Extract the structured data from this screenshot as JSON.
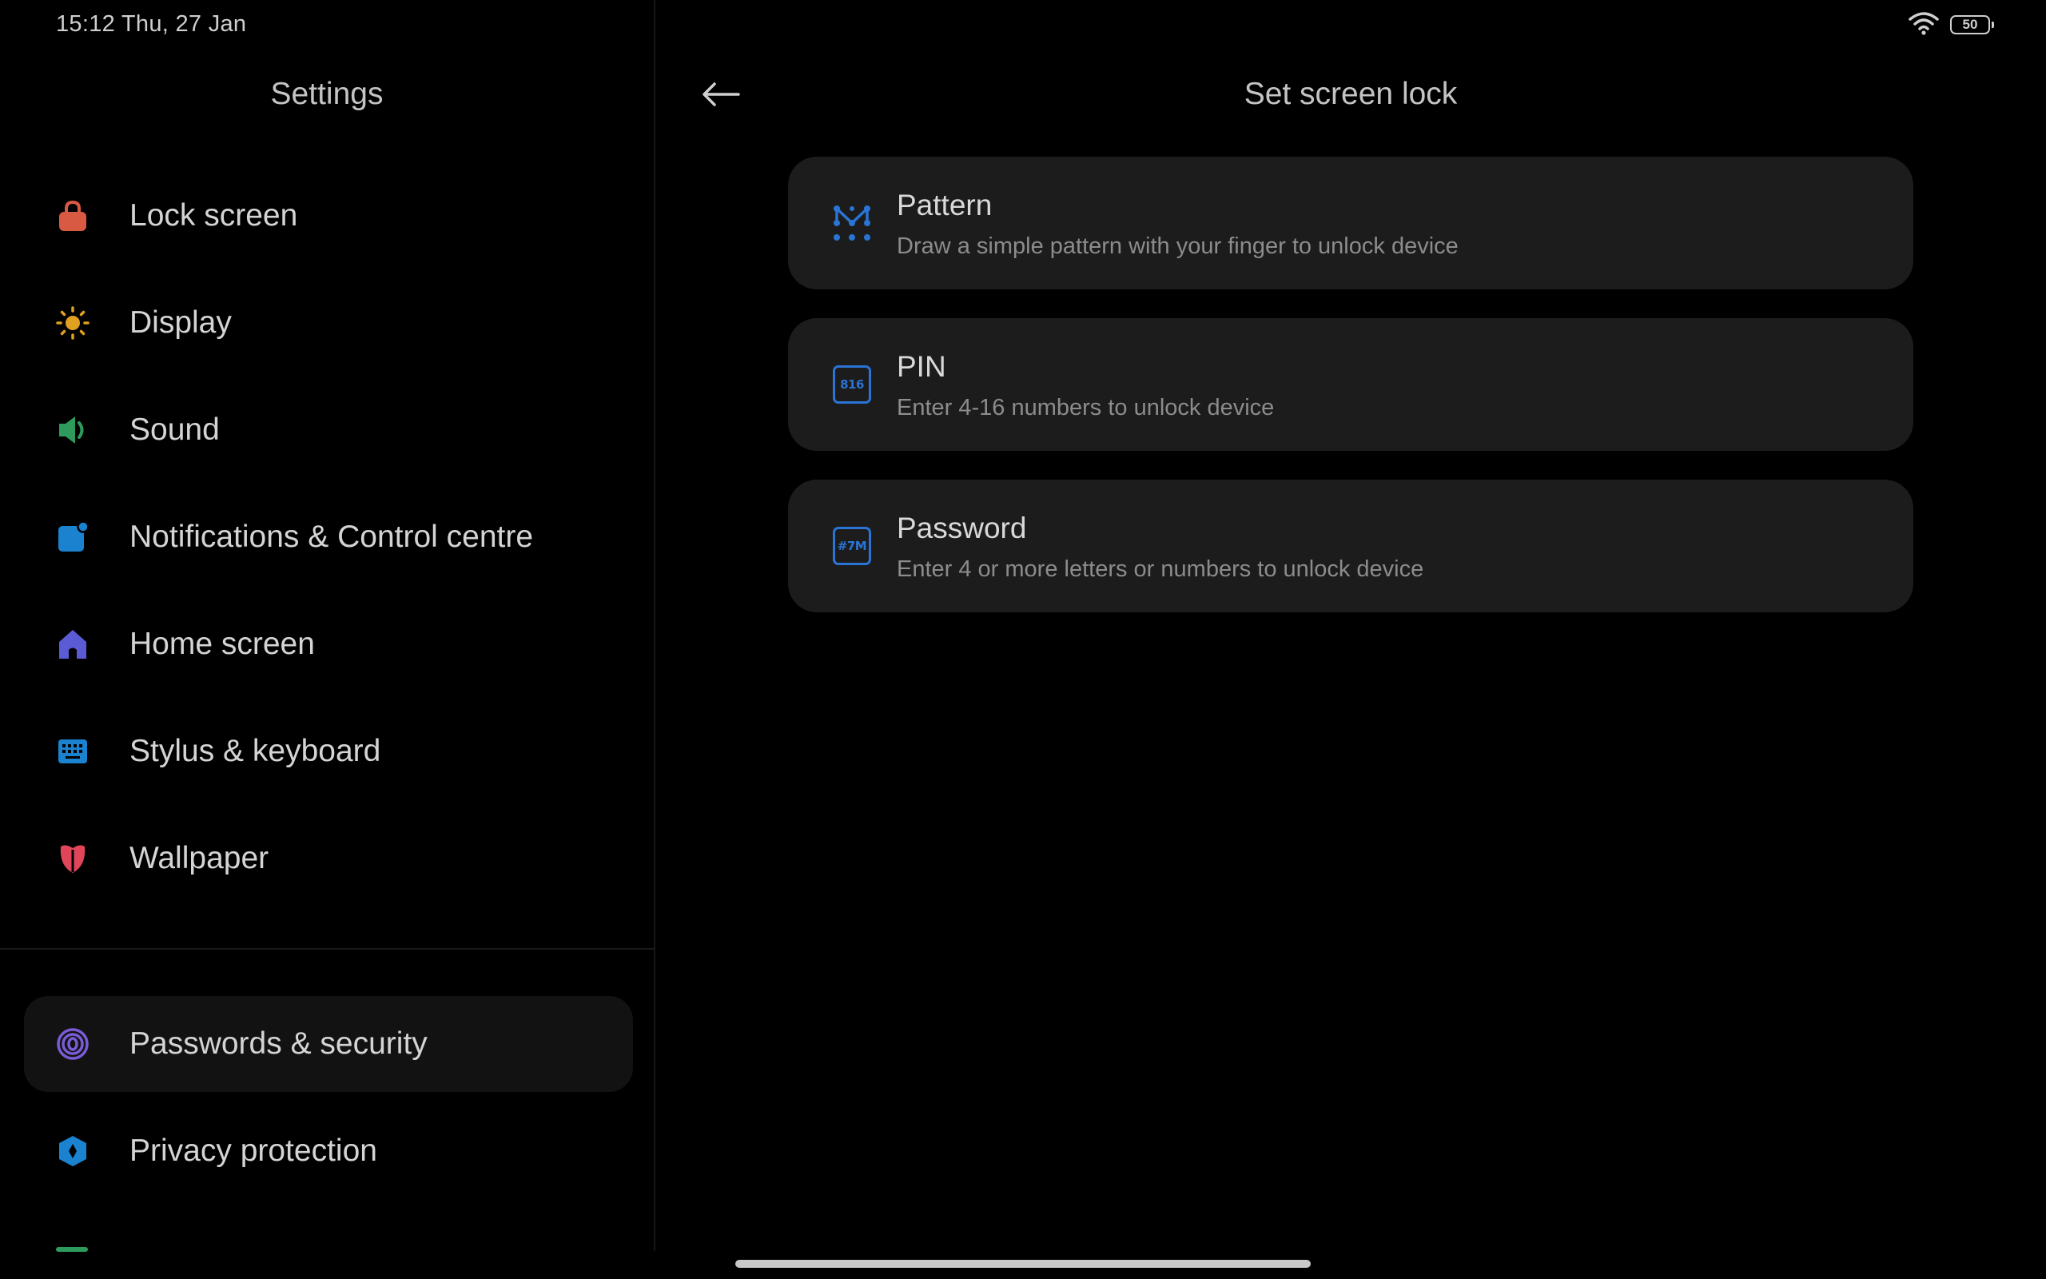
{
  "status_bar": {
    "time_date": "15:12  Thu, 27 Jan",
    "battery": "50",
    "wifi_icon": "wifi-icon"
  },
  "left_pane": {
    "title": "Settings",
    "items": [
      {
        "label": "Lock screen",
        "icon": "lock-icon",
        "color": "#d95a43"
      },
      {
        "label": "Display",
        "icon": "sun-icon",
        "color": "#e0a020"
      },
      {
        "label": "Sound",
        "icon": "speaker-icon",
        "color": "#2e9a5c"
      },
      {
        "label": "Notifications & Control centre",
        "icon": "notification-icon",
        "color": "#1a82cf"
      },
      {
        "label": "Home screen",
        "icon": "home-icon",
        "color": "#5b5bd6"
      },
      {
        "label": "Stylus & keyboard",
        "icon": "keyboard-icon",
        "color": "#1a82cf"
      },
      {
        "label": "Wallpaper",
        "icon": "flower-icon",
        "color": "#e0455a"
      },
      {
        "label": "Passwords & security",
        "icon": "fingerprint-icon",
        "color": "#7a5bd6",
        "active": true
      },
      {
        "label": "Privacy protection",
        "icon": "privacy-shield-icon",
        "color": "#1a82cf"
      }
    ]
  },
  "right_pane": {
    "title": "Set screen lock",
    "back_icon": "back-arrow-icon",
    "options": [
      {
        "title": "Pattern",
        "description": "Draw a simple pattern with your finger to unlock device",
        "icon": "pattern-icon"
      },
      {
        "title": "PIN",
        "description": "Enter 4-16 numbers to unlock device",
        "icon": "pin-icon",
        "icon_text": "816"
      },
      {
        "title": "Password",
        "description": "Enter 4 or more letters or numbers to unlock device",
        "icon": "password-icon",
        "icon_text": "#7M"
      }
    ]
  },
  "colors": {
    "background": "#000000",
    "card": "#1c1c1c",
    "accent_blue": "#2a74d6",
    "active_item": "#121212"
  }
}
